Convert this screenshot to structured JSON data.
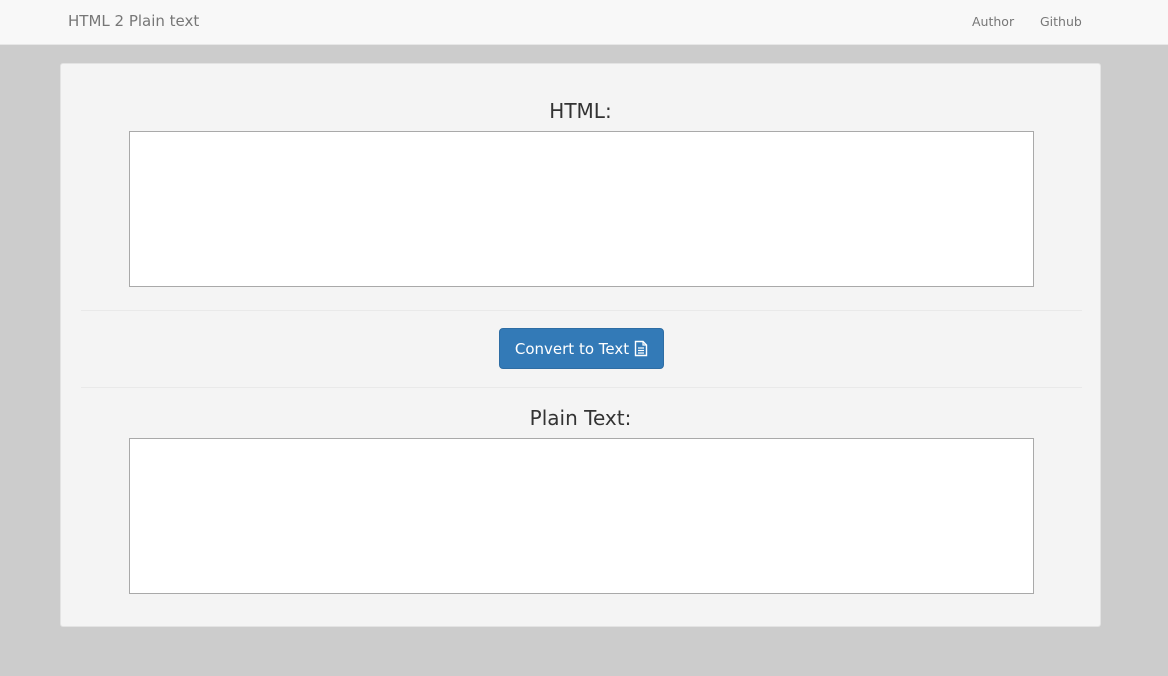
{
  "navbar": {
    "brand": "HTML 2 Plain text",
    "links": [
      {
        "label": "Author"
      },
      {
        "label": "Github"
      }
    ]
  },
  "main": {
    "html_label": "HTML:",
    "html_input_value": "",
    "convert_button_label": "Convert to Text",
    "convert_button_icon": "file-text-icon",
    "plain_label": "Plain Text:",
    "plain_output_value": ""
  },
  "colors": {
    "page_background": "#cccccc",
    "navbar_background": "#f8f8f8",
    "panel_background": "#f4f4f4",
    "button_primary": "#337ab7"
  }
}
